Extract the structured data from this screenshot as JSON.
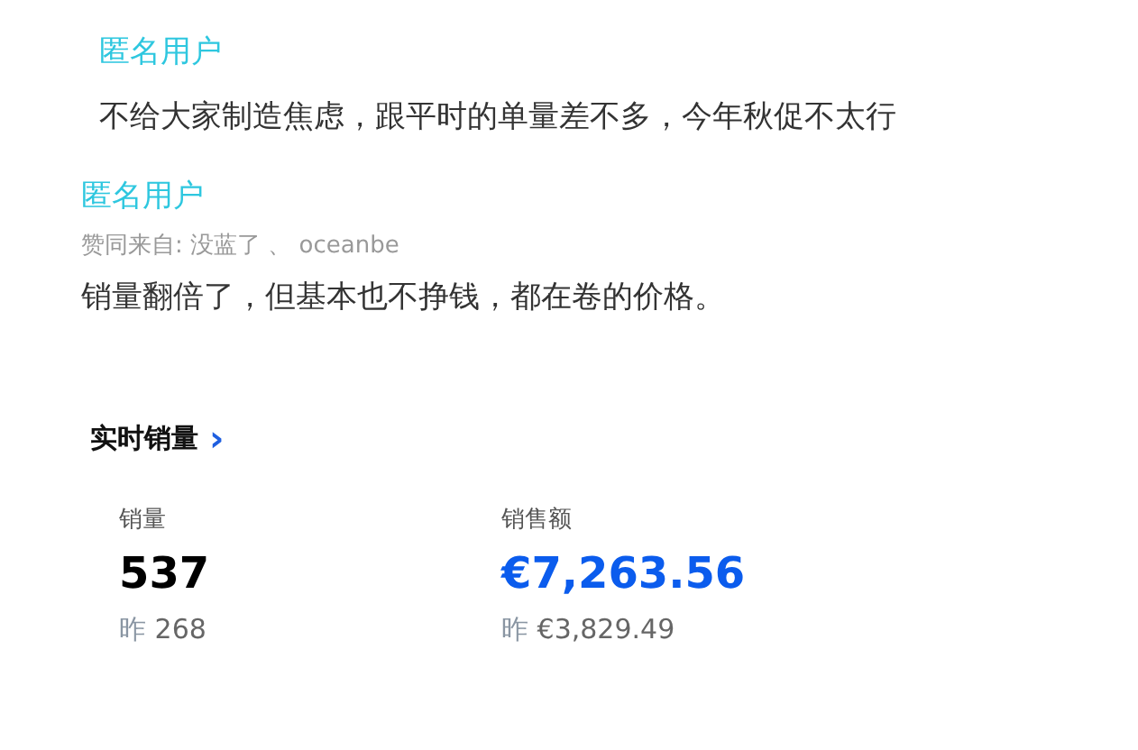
{
  "posts": [
    {
      "author": "匿名用户",
      "text": "不给大家制造焦虑，跟平时的单量差不多，今年秋促不太行"
    },
    {
      "author": "匿名用户",
      "endorsed_by": "赞同来自: 没蓝了 、 oceanbe",
      "text": "销量翻倍了，但基本也不挣钱，都在卷的价格。"
    }
  ],
  "sales": {
    "title": "实时销量",
    "chevron": "›",
    "metrics": [
      {
        "label": "销量",
        "value": "537",
        "highlight": false,
        "yesterday_label": "昨",
        "yesterday": "268"
      },
      {
        "label": "销售额",
        "value": "€7,263.56",
        "highlight": true,
        "yesterday_label": "昨",
        "yesterday": "€3,829.49"
      }
    ]
  }
}
